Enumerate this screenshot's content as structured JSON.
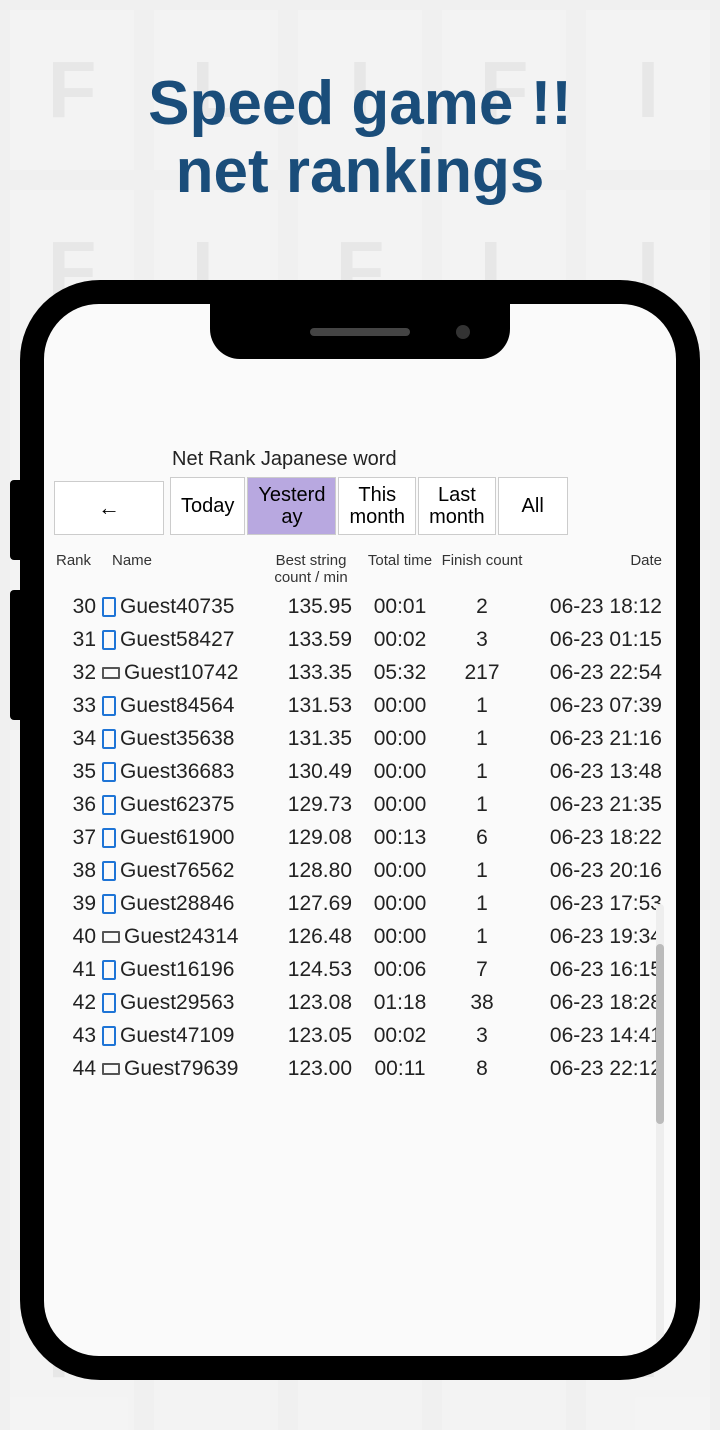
{
  "headline": {
    "line1": "Speed game !!",
    "line2": "net rankings"
  },
  "screen": {
    "title": "Net Rank Japanese word",
    "back": "←"
  },
  "tabs": [
    {
      "label": "Today",
      "active": false
    },
    {
      "label": "Yesterday",
      "active": true
    },
    {
      "label": "This month",
      "active": false
    },
    {
      "label": "Last month",
      "active": false
    },
    {
      "label": "All",
      "active": false
    }
  ],
  "columns": {
    "rank": "Rank",
    "name": "Name",
    "score": "Best string count / min",
    "time": "Total time",
    "finish": "Finish count",
    "date": "Date"
  },
  "rows": [
    {
      "rank": "30",
      "device": "mobile",
      "name": "Guest40735",
      "score": "135.95",
      "time": "00:01",
      "finish": "2",
      "date": "06-23 18:12"
    },
    {
      "rank": "31",
      "device": "mobile",
      "name": "Guest58427",
      "score": "133.59",
      "time": "00:02",
      "finish": "3",
      "date": "06-23 01:15"
    },
    {
      "rank": "32",
      "device": "desk",
      "name": "Guest10742",
      "score": "133.35",
      "time": "05:32",
      "finish": "217",
      "date": "06-23 22:54"
    },
    {
      "rank": "33",
      "device": "mobile",
      "name": "Guest84564",
      "score": "131.53",
      "time": "00:00",
      "finish": "1",
      "date": "06-23 07:39"
    },
    {
      "rank": "34",
      "device": "mobile",
      "name": "Guest35638",
      "score": "131.35",
      "time": "00:00",
      "finish": "1",
      "date": "06-23 21:16"
    },
    {
      "rank": "35",
      "device": "mobile",
      "name": "Guest36683",
      "score": "130.49",
      "time": "00:00",
      "finish": "1",
      "date": "06-23 13:48"
    },
    {
      "rank": "36",
      "device": "mobile",
      "name": "Guest62375",
      "score": "129.73",
      "time": "00:00",
      "finish": "1",
      "date": "06-23 21:35"
    },
    {
      "rank": "37",
      "device": "mobile",
      "name": "Guest61900",
      "score": "129.08",
      "time": "00:13",
      "finish": "6",
      "date": "06-23 18:22"
    },
    {
      "rank": "38",
      "device": "mobile",
      "name": "Guest76562",
      "score": "128.80",
      "time": "00:00",
      "finish": "1",
      "date": "06-23 20:16"
    },
    {
      "rank": "39",
      "device": "mobile",
      "name": "Guest28846",
      "score": "127.69",
      "time": "00:00",
      "finish": "1",
      "date": "06-23 17:53"
    },
    {
      "rank": "40",
      "device": "desk",
      "name": "Guest24314",
      "score": "126.48",
      "time": "00:00",
      "finish": "1",
      "date": "06-23 19:34"
    },
    {
      "rank": "41",
      "device": "mobile",
      "name": "Guest16196",
      "score": "124.53",
      "time": "00:06",
      "finish": "7",
      "date": "06-23 16:15"
    },
    {
      "rank": "42",
      "device": "mobile",
      "name": "Guest29563",
      "score": "123.08",
      "time": "01:18",
      "finish": "38",
      "date": "06-23 18:28"
    },
    {
      "rank": "43",
      "device": "mobile",
      "name": "Guest47109",
      "score": "123.05",
      "time": "00:02",
      "finish": "3",
      "date": "06-23 14:41"
    },
    {
      "rank": "44",
      "device": "desk",
      "name": "Guest79639",
      "score": "123.00",
      "time": "00:11",
      "finish": "8",
      "date": "06-23 22:12"
    }
  ]
}
